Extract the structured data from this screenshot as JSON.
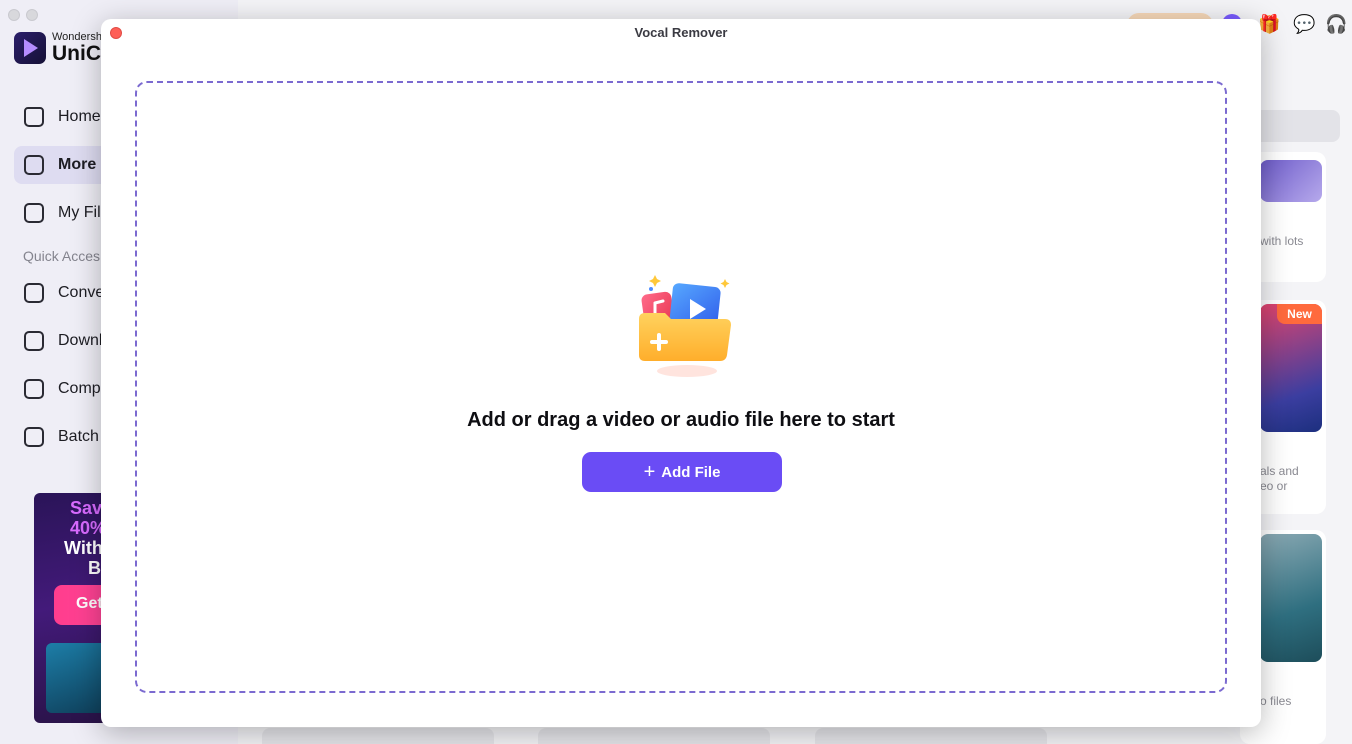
{
  "background_app": {
    "brand": {
      "small": "Wondersh",
      "big": "UniCo"
    },
    "nav": [
      {
        "label": "Home",
        "icon": "home-icon",
        "active": false
      },
      {
        "label": "More",
        "icon": "toolbox-icon",
        "active": true
      },
      {
        "label": "My Fil",
        "icon": "file-icon",
        "active": false
      }
    ],
    "quick_access_label": "Quick Acces",
    "quick_items": [
      {
        "label": "Conve",
        "icon": "convert-icon"
      },
      {
        "label": "Downl",
        "icon": "download-icon"
      },
      {
        "label": "Comp",
        "icon": "compress-icon"
      },
      {
        "label": "Batch",
        "icon": "image-icon"
      }
    ],
    "promo": {
      "line1": "Sav",
      "line1b": "40%",
      "line2": "With",
      "line2b": "B",
      "button": "Get"
    },
    "right_cards": [
      {
        "text": "with lots"
      },
      {
        "badge": "New",
        "text": "als and\neo or"
      },
      {
        "text": "o files"
      }
    ]
  },
  "modal": {
    "title": "Vocal Remover",
    "prompt": "Add or drag a video or audio file here to start",
    "add_button": "Add File",
    "accent": "#6a4cf5"
  }
}
